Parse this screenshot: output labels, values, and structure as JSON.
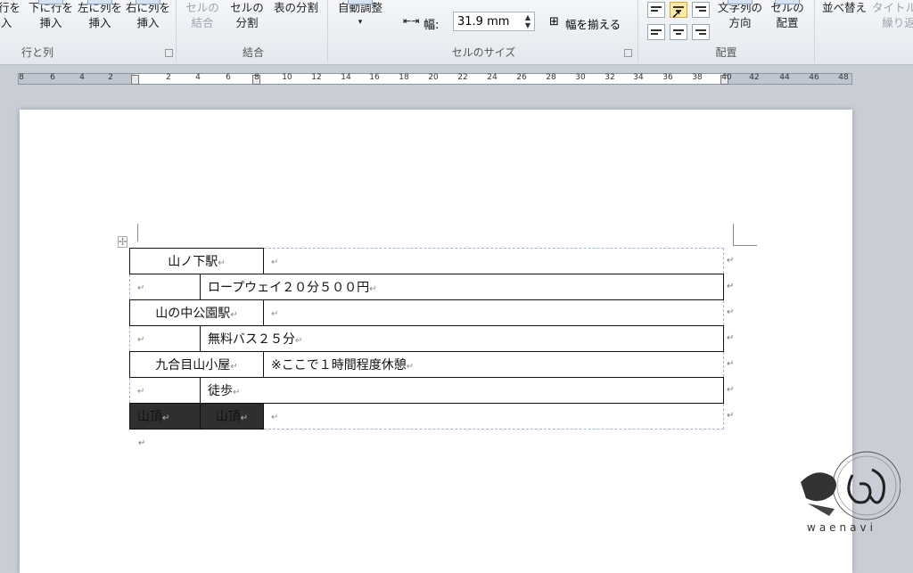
{
  "ribbon": {
    "buttons": [
      {
        "line1": "行を",
        "line2": "入"
      },
      {
        "line1": "下に行を",
        "line2": "挿入"
      },
      {
        "line1": "左に列を",
        "line2": "挿入"
      },
      {
        "line1": "右に列を",
        "line2": "挿入"
      },
      {
        "line1": "セルの",
        "line2": "結合"
      },
      {
        "line1": "セルの",
        "line2": "分割"
      },
      {
        "line1": "表の分割",
        "line2": ""
      },
      {
        "line1": "自動調整",
        "line2": "▾"
      },
      {
        "line1": "文字列の",
        "line2": "方向"
      },
      {
        "line1": "セルの",
        "line2": "配置"
      },
      {
        "line1": "並べ替え",
        "line2": ""
      },
      {
        "line1": "タイトル行",
        "line2": "繰り返"
      }
    ],
    "groups": [
      "行と列",
      "結合",
      "セルのサイズ",
      "配置"
    ],
    "width_label": "幅:",
    "width_value": "31.9 mm",
    "distribute_label": "幅を揃える"
  },
  "ruler": {
    "numbers": [
      "8",
      "6",
      "4",
      "2",
      "2",
      "4",
      "6",
      "8",
      "10",
      "12",
      "14",
      "16",
      "18",
      "20",
      "22",
      "24",
      "26",
      "28",
      "30",
      "32",
      "34",
      "36",
      "38",
      "40",
      "42",
      "44",
      "46",
      "48"
    ]
  },
  "table": {
    "rows": [
      {
        "station": "山ノ下駅",
        "detail": ""
      },
      {
        "station": "",
        "detail": "ロープウェイ２０分５００円"
      },
      {
        "station": "山の中公園駅",
        "detail": ""
      },
      {
        "station": "",
        "detail": "無料バス２５分"
      },
      {
        "station": "九合目山小屋",
        "detail": "※ここで１時間程度休憩"
      },
      {
        "station": "",
        "detail": "徒歩"
      },
      {
        "station_a": "山頂",
        "station_b": "山頂",
        "detail": ""
      }
    ],
    "para_mark": "↵"
  },
  "watermark": {
    "text": "waenavi"
  },
  "colors": {
    "selection": "#2f2f2f",
    "cell_gridline": "#9fb5d3",
    "ribbon_hover": "#fde9a6"
  }
}
